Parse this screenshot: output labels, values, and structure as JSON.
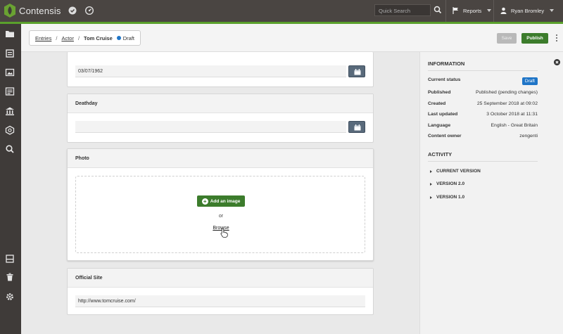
{
  "app": {
    "name": "Contensis"
  },
  "header": {
    "search_placeholder": "Quick Search",
    "reports_label": "Reports",
    "user_name": "Ryan Bromley"
  },
  "breadcrumb": {
    "items": [
      "Entries",
      "Actor"
    ],
    "current": "Tom Cruise",
    "status": "Draft"
  },
  "toolbar": {
    "save_label": "Save",
    "publish_label": "Publish"
  },
  "fields": {
    "birthday_value": "03/07/1962",
    "deathday_label": "Deathday",
    "deathday_value": "",
    "photo_label": "Photo",
    "add_image_label": "Add an image",
    "or_text": "or",
    "browse_label": "Browse",
    "official_site_label": "Official Site",
    "official_site_value": "http://www.tomcruise.com/"
  },
  "information": {
    "title": "INFORMATION",
    "rows": [
      {
        "key": "Current status",
        "value": "Draft"
      },
      {
        "key": "Published",
        "value": "Published (pending changes)"
      },
      {
        "key": "Created",
        "value": "25 September 2018 at 09:02"
      },
      {
        "key": "Last updated",
        "value": "3 October 2018 at 11:31"
      },
      {
        "key": "Language",
        "value": "English - Great Britain"
      },
      {
        "key": "Content owner",
        "value": "zengenti"
      }
    ]
  },
  "activity": {
    "title": "ACTIVITY",
    "versions": [
      "CURRENT VERSION",
      "VERSION 2.0",
      "VERSION 1.0"
    ]
  },
  "colors": {
    "accent_green": "#3c7c2c",
    "draft_blue": "#1f75c7",
    "topbar": "#4a4542"
  },
  "icons": {
    "top": [
      "check-circle-icon",
      "dashboard-icon",
      "search-icon",
      "flag-icon",
      "user-icon"
    ],
    "nav": [
      "folder-icon",
      "entries-icon",
      "image-icon",
      "list-icon",
      "bank-icon",
      "cube-icon",
      "search-icon",
      "archive-icon",
      "trash-icon",
      "gear-icon"
    ]
  }
}
